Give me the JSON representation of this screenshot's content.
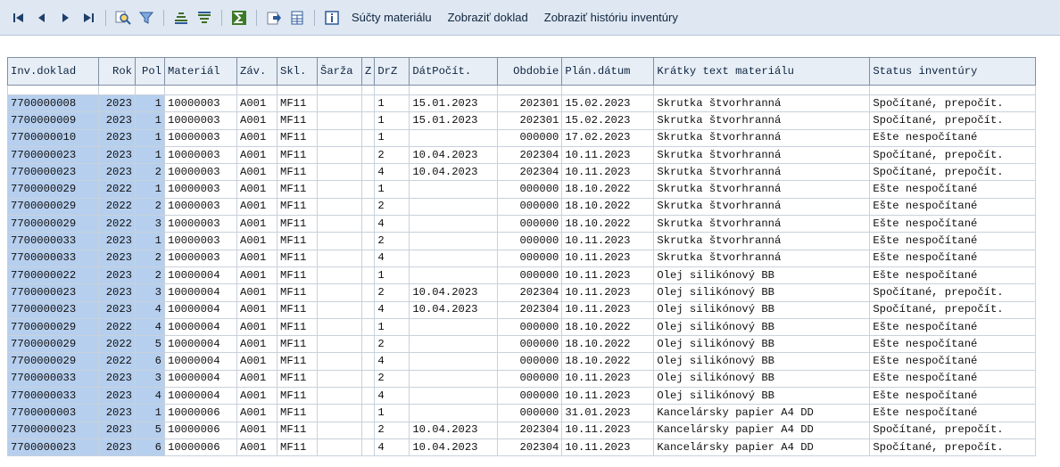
{
  "toolbar": {
    "icons": [
      "first-page-icon",
      "previous-page-icon",
      "next-page-icon",
      "last-page-icon",
      "search-icon",
      "filter-icon",
      "sort-ascending-icon",
      "sort-descending-icon",
      "sum-icon",
      "export-icon",
      "spreadsheet-icon",
      "info-icon"
    ],
    "text_buttons": [
      "Súčty materiálu",
      "Zobraziť doklad",
      "Zobraziť históriu inventúry"
    ]
  },
  "table": {
    "headers": [
      "Inv.doklad",
      "Rok",
      "Pol",
      "Materiál",
      "Záv.",
      "Skl.",
      "Šarža",
      "Z",
      "DrZ",
      "DátPočít.",
      "Obdobie",
      "Plán.dátum",
      "Krátky text materiálu",
      "Status inventúry"
    ],
    "rows": [
      [
        "7700000008",
        "2023",
        "1",
        "10000003",
        "A001",
        "MF11",
        "",
        "",
        "1",
        "15.01.2023",
        "202301",
        "15.02.2023",
        "Skrutka štvorhranná",
        "Spočítané, prepočít."
      ],
      [
        "7700000009",
        "2023",
        "1",
        "10000003",
        "A001",
        "MF11",
        "",
        "",
        "1",
        "15.01.2023",
        "202301",
        "15.02.2023",
        "Skrutka štvorhranná",
        "Spočítané, prepočít."
      ],
      [
        "7700000010",
        "2023",
        "1",
        "10000003",
        "A001",
        "MF11",
        "",
        "",
        "1",
        "",
        "000000",
        "17.02.2023",
        "Skrutka štvorhranná",
        "Ešte nespočítané"
      ],
      [
        "7700000023",
        "2023",
        "1",
        "10000003",
        "A001",
        "MF11",
        "",
        "",
        "2",
        "10.04.2023",
        "202304",
        "10.11.2023",
        "Skrutka štvorhranná",
        "Spočítané, prepočít."
      ],
      [
        "7700000023",
        "2023",
        "2",
        "10000003",
        "A001",
        "MF11",
        "",
        "",
        "4",
        "10.04.2023",
        "202304",
        "10.11.2023",
        "Skrutka štvorhranná",
        "Spočítané, prepočít."
      ],
      [
        "7700000029",
        "2022",
        "1",
        "10000003",
        "A001",
        "MF11",
        "",
        "",
        "1",
        "",
        "000000",
        "18.10.2022",
        "Skrutka štvorhranná",
        "Ešte nespočítané"
      ],
      [
        "7700000029",
        "2022",
        "2",
        "10000003",
        "A001",
        "MF11",
        "",
        "",
        "2",
        "",
        "000000",
        "18.10.2022",
        "Skrutka štvorhranná",
        "Ešte nespočítané"
      ],
      [
        "7700000029",
        "2022",
        "3",
        "10000003",
        "A001",
        "MF11",
        "",
        "",
        "4",
        "",
        "000000",
        "18.10.2022",
        "Skrutka štvorhranná",
        "Ešte nespočítané"
      ],
      [
        "7700000033",
        "2023",
        "1",
        "10000003",
        "A001",
        "MF11",
        "",
        "",
        "2",
        "",
        "000000",
        "10.11.2023",
        "Skrutka štvorhranná",
        "Ešte nespočítané"
      ],
      [
        "7700000033",
        "2023",
        "2",
        "10000003",
        "A001",
        "MF11",
        "",
        "",
        "4",
        "",
        "000000",
        "10.11.2023",
        "Skrutka štvorhranná",
        "Ešte nespočítané"
      ],
      [
        "7700000022",
        "2023",
        "2",
        "10000004",
        "A001",
        "MF11",
        "",
        "",
        "1",
        "",
        "000000",
        "10.11.2023",
        "Olej silikónový BB",
        "Ešte nespočítané"
      ],
      [
        "7700000023",
        "2023",
        "3",
        "10000004",
        "A001",
        "MF11",
        "",
        "",
        "2",
        "10.04.2023",
        "202304",
        "10.11.2023",
        "Olej silikónový BB",
        "Spočítané, prepočít."
      ],
      [
        "7700000023",
        "2023",
        "4",
        "10000004",
        "A001",
        "MF11",
        "",
        "",
        "4",
        "10.04.2023",
        "202304",
        "10.11.2023",
        "Olej silikónový BB",
        "Spočítané, prepočít."
      ],
      [
        "7700000029",
        "2022",
        "4",
        "10000004",
        "A001",
        "MF11",
        "",
        "",
        "1",
        "",
        "000000",
        "18.10.2022",
        "Olej silikónový BB",
        "Ešte nespočítané"
      ],
      [
        "7700000029",
        "2022",
        "5",
        "10000004",
        "A001",
        "MF11",
        "",
        "",
        "2",
        "",
        "000000",
        "18.10.2022",
        "Olej silikónový BB",
        "Ešte nespočítané"
      ],
      [
        "7700000029",
        "2022",
        "6",
        "10000004",
        "A001",
        "MF11",
        "",
        "",
        "4",
        "",
        "000000",
        "18.10.2022",
        "Olej silikónový BB",
        "Ešte nespočítané"
      ],
      [
        "7700000033",
        "2023",
        "3",
        "10000004",
        "A001",
        "MF11",
        "",
        "",
        "2",
        "",
        "000000",
        "10.11.2023",
        "Olej silikónový BB",
        "Ešte nespočítané"
      ],
      [
        "7700000033",
        "2023",
        "4",
        "10000004",
        "A001",
        "MF11",
        "",
        "",
        "4",
        "",
        "000000",
        "10.11.2023",
        "Olej silikónový BB",
        "Ešte nespočítané"
      ],
      [
        "7700000003",
        "2023",
        "1",
        "10000006",
        "A001",
        "MF11",
        "",
        "",
        "1",
        "",
        "000000",
        "31.01.2023",
        "Kancelársky papier A4 DD",
        "Ešte nespočítané"
      ],
      [
        "7700000023",
        "2023",
        "5",
        "10000006",
        "A001",
        "MF11",
        "",
        "",
        "2",
        "10.04.2023",
        "202304",
        "10.11.2023",
        "Kancelársky papier A4 DD",
        "Spočítané, prepočít."
      ],
      [
        "7700000023",
        "2023",
        "6",
        "10000006",
        "A001",
        "MF11",
        "",
        "",
        "4",
        "10.04.2023",
        "202304",
        "10.11.2023",
        "Kancelársky papier A4 DD",
        "Spočítané, prepočít."
      ]
    ]
  },
  "colors": {
    "toolbar_bg": "#dfe8f2",
    "key_cell_bg": "#b6cfee",
    "header_bg": "#e7eef6"
  }
}
